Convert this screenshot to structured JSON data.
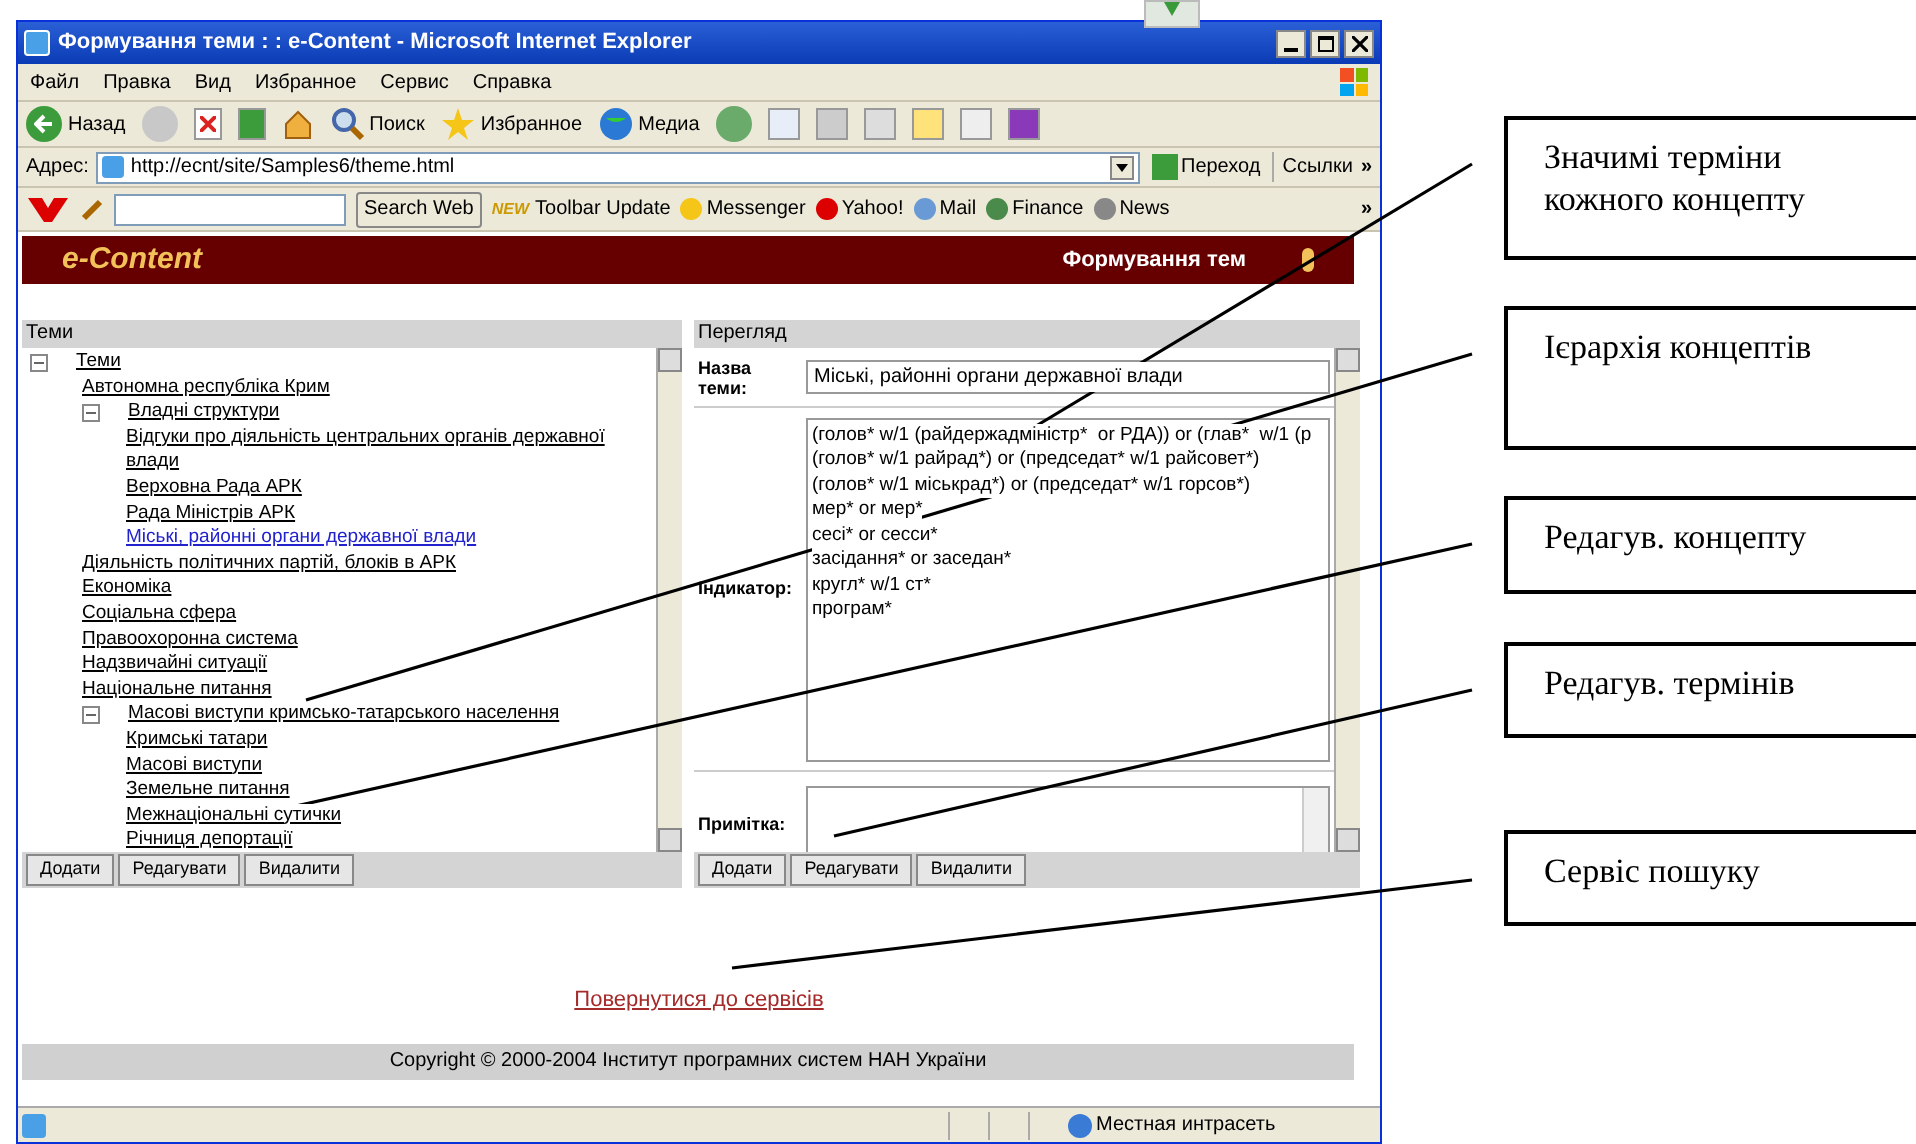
{
  "window": {
    "title": "Формування теми : : e-Content - Microsoft Internet Explorer"
  },
  "menu": [
    "Файл",
    "Правка",
    "Вид",
    "Избранное",
    "Сервис",
    "Справка"
  ],
  "toolbar": {
    "back": "Назад",
    "search": "Поиск",
    "favorites": "Избранное",
    "media": "Медиа"
  },
  "address_bar": {
    "label": "Адрес:",
    "url": "http://ecnt/site/Samples6/theme.html",
    "go": "Переход",
    "links": "Ссылки",
    "more": "»"
  },
  "yahoo_toolbar": {
    "search_button": "Search Web",
    "new_badge": "NEW",
    "update": "Toolbar Update",
    "items": [
      "Messenger",
      "Yahoo!",
      "Mail",
      "Finance",
      "News"
    ],
    "more": "»"
  },
  "site_header": {
    "logo": "e-Content",
    "title": "Формування тем"
  },
  "themes_panel": {
    "title": "Теми",
    "tree": [
      {
        "label": "Теми",
        "selected": false,
        "expanded": true,
        "children": [
          {
            "label": "Автономна республіка Крим",
            "selected": false
          },
          {
            "label": "Владні структури",
            "selected": false,
            "expanded": true,
            "children": [
              {
                "label": "Відгуки про діяльність центральних органів державної влади",
                "selected": false
              },
              {
                "label": "Верховна Рада АРК",
                "selected": false
              },
              {
                "label": "Рада Міністрів АРК",
                "selected": false
              },
              {
                "label": "Міські, районні органи державної влади",
                "selected": true
              }
            ]
          },
          {
            "label": "Діяльність політичних партій, блоків в АРК",
            "selected": false
          },
          {
            "label": "Економіка",
            "selected": false
          },
          {
            "label": "Соціальна сфера",
            "selected": false
          },
          {
            "label": "Правоохоронна система",
            "selected": false
          },
          {
            "label": "Надзвичайні ситуації",
            "selected": false
          },
          {
            "label": "Національне питання",
            "selected": false
          },
          {
            "label": "Масові виступи кримсько-татарського населення",
            "selected": false,
            "expanded": true,
            "children": [
              {
                "label": "Кримські татари",
                "selected": false
              },
              {
                "label": "Масові виступи",
                "selected": false
              },
              {
                "label": "Земельне питання",
                "selected": false
              },
              {
                "label": "Межнаціональні сутички",
                "selected": false
              },
              {
                "label": "Річниця депортації",
                "selected": false
              }
            ]
          }
        ]
      }
    ],
    "buttons": [
      "Додати",
      "Редагувати",
      "Видалити"
    ]
  },
  "view_panel": {
    "title": "Перегляд",
    "name_label": "Назва теми:",
    "name_value": "Міські, районні органи державної влади",
    "indicator_label": "Індикатор:",
    "indicator_lines": [
      "(голов* w/1 (райдержадміністр*  or РДА)) or (глав*  w/1 (р",
      "(голов* w/1 райрад*) or (председат* w/1 райсовет*)",
      "(голов* w/1 міськрад*) or (председат* w/1 горсов*)",
      "мер* or мер*",
      "сесі* or сесси*",
      "засідання* or заседан*",
      "кругл* w/1 ст*",
      "програм*"
    ],
    "note_label": "Примітка:",
    "buttons": [
      "Додати",
      "Редагувати",
      "Видалити"
    ]
  },
  "back_link": "Повернутися до сервісів",
  "copyright": "Copyright © 2000-2004 Інститут програмних систем НАН України",
  "status_bar": {
    "zone": "Местная интрасеть"
  },
  "callouts": [
    {
      "text": "Значимі терміни кожного концепту"
    },
    {
      "text": "Ієрархія концептів"
    },
    {
      "text": "Редагув. концепту"
    },
    {
      "text": "Редагув. термінів"
    },
    {
      "text": "Сервіс пошуку"
    }
  ]
}
